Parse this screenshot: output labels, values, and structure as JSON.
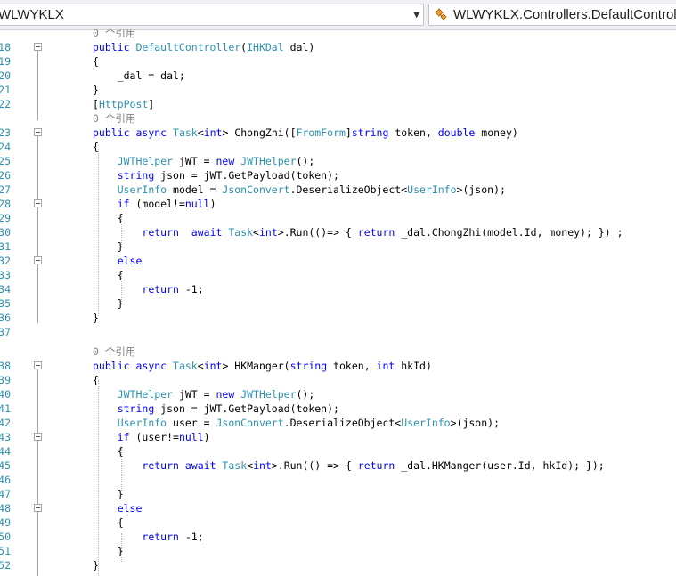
{
  "nav": {
    "left_label": "WLWYKLX",
    "right_label": "WLWYKLX.Controllers.DefaultController"
  },
  "colors": {
    "keyword": "#0000ff",
    "type": "#2b91af",
    "string": "#a31515",
    "linenumber": "#2b91af",
    "refcount": "#808080"
  },
  "lines": [
    {
      "n": "",
      "ref": "0 个引用"
    },
    {
      "n": "18",
      "t": [
        [
          "public ",
          "k"
        ],
        [
          "DefaultController",
          "t"
        ],
        [
          "(",
          ""
        ],
        [
          "IHKDal",
          "t"
        ],
        [
          " dal)",
          ""
        ]
      ]
    },
    {
      "n": "19",
      "t": [
        [
          "{",
          ""
        ]
      ]
    },
    {
      "n": "20",
      "t": [
        [
          "    _dal = dal;",
          ""
        ]
      ]
    },
    {
      "n": "21",
      "t": [
        [
          "}",
          ""
        ]
      ]
    },
    {
      "n": "22",
      "t": [
        [
          "[",
          ""
        ],
        [
          "HttpPost",
          "t"
        ],
        [
          "]",
          ""
        ]
      ]
    },
    {
      "n": "",
      "ref": "0 个引用"
    },
    {
      "n": "23",
      "t": [
        [
          "public ",
          "k"
        ],
        [
          "async ",
          "k"
        ],
        [
          "Task",
          "t"
        ],
        [
          "<",
          ""
        ],
        [
          "int",
          "k"
        ],
        [
          "> ChongZhi([",
          ""
        ],
        [
          "FromForm",
          "t"
        ],
        [
          "]",
          ""
        ],
        [
          "string",
          "k"
        ],
        [
          " token, ",
          ""
        ],
        [
          "double",
          "k"
        ],
        [
          " money)",
          ""
        ]
      ]
    },
    {
      "n": "24",
      "t": [
        [
          "{",
          ""
        ]
      ]
    },
    {
      "n": "25",
      "t": [
        [
          "    ",
          ""
        ],
        [
          "JWTHelper",
          "t"
        ],
        [
          " jWT = ",
          ""
        ],
        [
          "new ",
          "k"
        ],
        [
          "JWTHelper",
          "t"
        ],
        [
          "();",
          ""
        ]
      ]
    },
    {
      "n": "26",
      "t": [
        [
          "    ",
          ""
        ],
        [
          "string",
          "k"
        ],
        [
          " json = jWT.GetPayload(token);",
          ""
        ]
      ]
    },
    {
      "n": "27",
      "t": [
        [
          "    ",
          ""
        ],
        [
          "UserInfo",
          "t"
        ],
        [
          " model = ",
          ""
        ],
        [
          "JsonConvert",
          "t"
        ],
        [
          ".DeserializeObject<",
          ""
        ],
        [
          "UserInfo",
          "t"
        ],
        [
          ">(json);",
          ""
        ]
      ]
    },
    {
      "n": "28",
      "t": [
        [
          "    ",
          ""
        ],
        [
          "if",
          "k"
        ],
        [
          " (model!=",
          ""
        ],
        [
          "null",
          "k"
        ],
        [
          ")",
          ""
        ]
      ]
    },
    {
      "n": "29",
      "t": [
        [
          "    {",
          ""
        ]
      ]
    },
    {
      "n": "30",
      "t": [
        [
          "        ",
          ""
        ],
        [
          "return",
          "k"
        ],
        [
          "  ",
          ""
        ],
        [
          "await ",
          "k"
        ],
        [
          "Task",
          "t"
        ],
        [
          "<",
          ""
        ],
        [
          "int",
          "k"
        ],
        [
          ">.Run(()=> { ",
          ""
        ],
        [
          "return",
          "k"
        ],
        [
          " _dal.ChongZhi(model.Id, money); }) ;",
          ""
        ]
      ]
    },
    {
      "n": "31",
      "t": [
        [
          "    }",
          ""
        ]
      ]
    },
    {
      "n": "32",
      "t": [
        [
          "    ",
          ""
        ],
        [
          "else",
          "k"
        ]
      ]
    },
    {
      "n": "33",
      "t": [
        [
          "    {",
          ""
        ]
      ]
    },
    {
      "n": "34",
      "t": [
        [
          "        ",
          ""
        ],
        [
          "return",
          "k"
        ],
        [
          " -1;",
          ""
        ]
      ]
    },
    {
      "n": "35",
      "t": [
        [
          "    }",
          ""
        ]
      ]
    },
    {
      "n": "36",
      "t": [
        [
          "}",
          ""
        ]
      ]
    },
    {
      "n": "37",
      "t": [
        [
          "",
          ""
        ]
      ]
    },
    {
      "n": "",
      "ref": "0 个引用"
    },
    {
      "n": "38",
      "t": [
        [
          "public ",
          "k"
        ],
        [
          "async ",
          "k"
        ],
        [
          "Task",
          "t"
        ],
        [
          "<",
          ""
        ],
        [
          "int",
          "k"
        ],
        [
          "> HKManger(",
          ""
        ],
        [
          "string",
          "k"
        ],
        [
          " token, ",
          ""
        ],
        [
          "int",
          "k"
        ],
        [
          " hkId)",
          ""
        ]
      ]
    },
    {
      "n": "39",
      "t": [
        [
          "{",
          ""
        ]
      ]
    },
    {
      "n": "40",
      "t": [
        [
          "    ",
          ""
        ],
        [
          "JWTHelper",
          "t"
        ],
        [
          " jWT = ",
          ""
        ],
        [
          "new ",
          "k"
        ],
        [
          "JWTHelper",
          "t"
        ],
        [
          "();",
          ""
        ]
      ]
    },
    {
      "n": "41",
      "t": [
        [
          "    ",
          ""
        ],
        [
          "string",
          "k"
        ],
        [
          " json = jWT.GetPayload(token);",
          ""
        ]
      ]
    },
    {
      "n": "42",
      "t": [
        [
          "    ",
          ""
        ],
        [
          "UserInfo",
          "t"
        ],
        [
          " user = ",
          ""
        ],
        [
          "JsonConvert",
          "t"
        ],
        [
          ".DeserializeObject<",
          ""
        ],
        [
          "UserInfo",
          "t"
        ],
        [
          ">(json);",
          ""
        ]
      ]
    },
    {
      "n": "43",
      "t": [
        [
          "    ",
          ""
        ],
        [
          "if",
          "k"
        ],
        [
          " (user!=",
          ""
        ],
        [
          "null",
          "k"
        ],
        [
          ")",
          ""
        ]
      ]
    },
    {
      "n": "44",
      "t": [
        [
          "    {",
          ""
        ]
      ]
    },
    {
      "n": "45",
      "t": [
        [
          "        ",
          ""
        ],
        [
          "return",
          "k"
        ],
        [
          " ",
          ""
        ],
        [
          "await ",
          "k"
        ],
        [
          "Task",
          "t"
        ],
        [
          "<",
          ""
        ],
        [
          "int",
          "k"
        ],
        [
          ">.Run(() => { ",
          ""
        ],
        [
          "return",
          "k"
        ],
        [
          " _dal.HKManger(user.Id, hkId); });",
          ""
        ]
      ]
    },
    {
      "n": "46",
      "t": [
        [
          "",
          ""
        ]
      ]
    },
    {
      "n": "47",
      "t": [
        [
          "    }",
          ""
        ]
      ]
    },
    {
      "n": "48",
      "t": [
        [
          "    ",
          ""
        ],
        [
          "else",
          "k"
        ]
      ]
    },
    {
      "n": "49",
      "t": [
        [
          "    {",
          ""
        ]
      ]
    },
    {
      "n": "50",
      "t": [
        [
          "        ",
          ""
        ],
        [
          "return",
          "k"
        ],
        [
          " -1;",
          ""
        ]
      ]
    },
    {
      "n": "51",
      "t": [
        [
          "    }",
          ""
        ]
      ]
    },
    {
      "n": "52",
      "t": [
        [
          "}",
          ""
        ]
      ]
    }
  ]
}
